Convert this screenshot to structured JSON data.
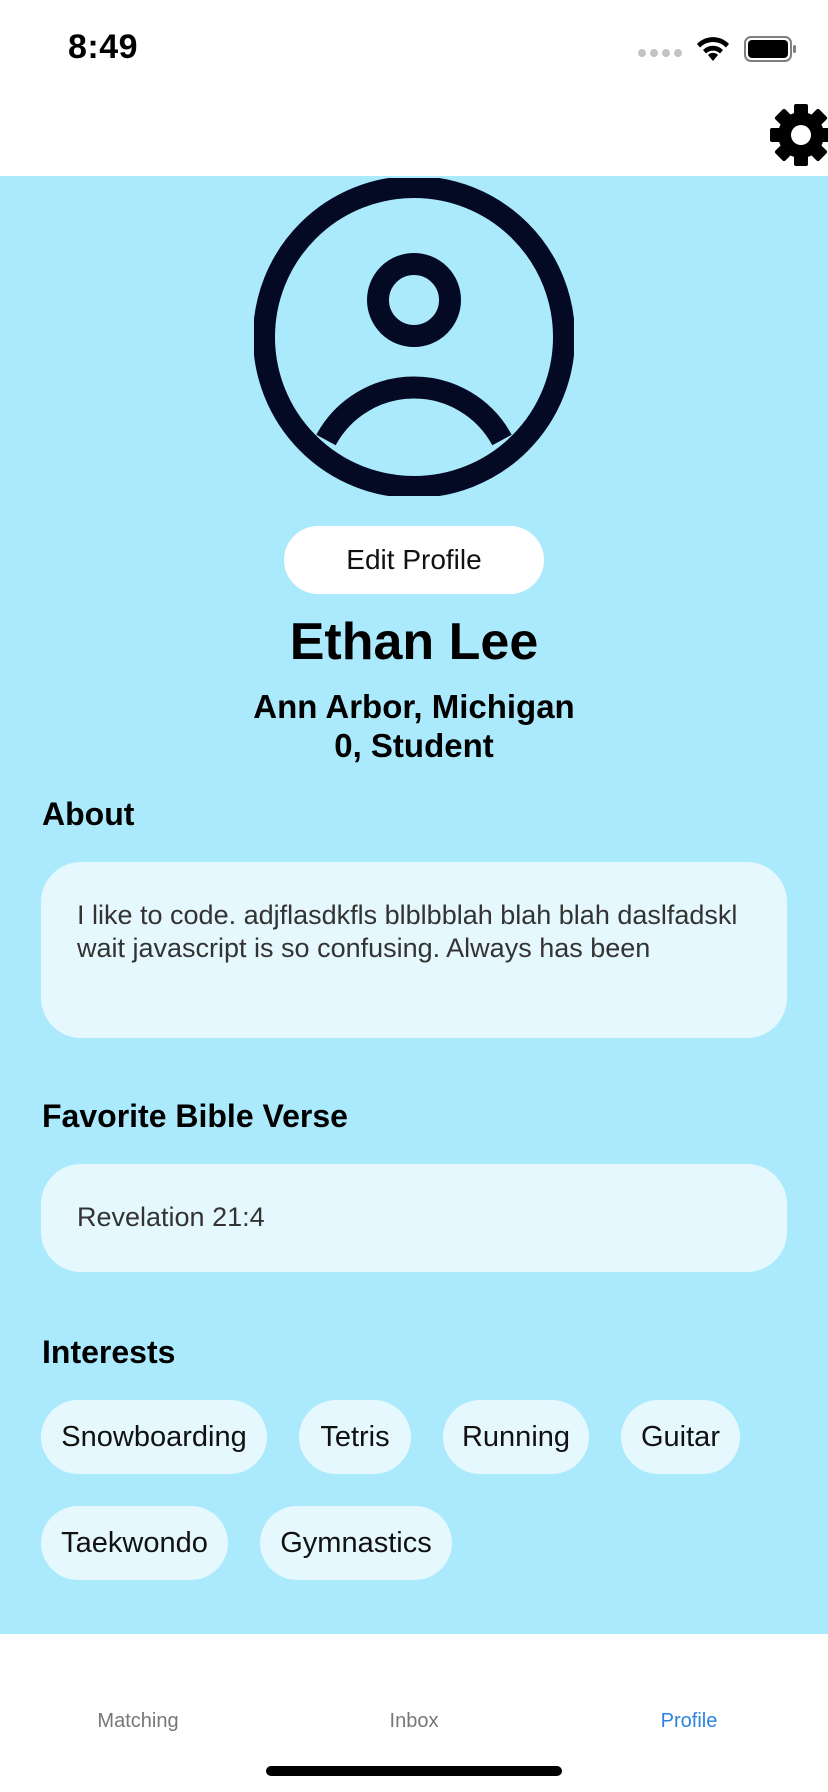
{
  "status_bar": {
    "time": "8:49",
    "icons": [
      "cellular-dots-icon",
      "wifi-icon",
      "battery-icon"
    ]
  },
  "top_bar": {
    "settings_icon": "gear-icon"
  },
  "profile": {
    "avatar_icon": "user-circle-icon",
    "edit_label": "Edit Profile",
    "name": "Ethan Lee",
    "location": "Ann Arbor, Michigan",
    "occupation": "0, Student"
  },
  "about": {
    "title": "About",
    "text": "I like to code. adjflasdkfls blblbblah blah blah daslfadskl wait javascript is so confusing. Always has been"
  },
  "verse": {
    "title": "Favorite Bible Verse",
    "text": "Revelation 21:4"
  },
  "interests": {
    "title": "Interests",
    "items": [
      "Snowboarding",
      "Tetris",
      "Running",
      "Guitar",
      "Taekwondo",
      "Gymnastics"
    ]
  },
  "tabs": [
    {
      "label": "Matching",
      "active": false
    },
    {
      "label": "Inbox",
      "active": false
    },
    {
      "label": "Profile",
      "active": true
    }
  ],
  "colors": {
    "background": "#aaeafc",
    "card": "#e5f8fe",
    "active_tab": "#2a84e0",
    "avatar": "#050a24"
  }
}
